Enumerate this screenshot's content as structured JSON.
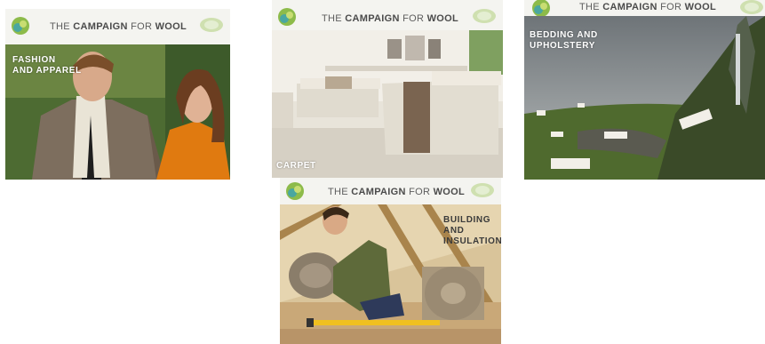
{
  "header_text_light": "THE ",
  "header_text_bold": "CAMPAIGN",
  "header_text_light2": " FOR ",
  "header_text_bold2": "WOOL",
  "panels": [
    {
      "lines": [
        "FASHION",
        "AND APPAREL"
      ]
    },
    {
      "lines": [
        "CARPET"
      ]
    },
    {
      "lines": [
        "BEDDING AND",
        "UPHOLSTERY"
      ]
    },
    {
      "lines": [
        "BUILDING AND",
        "INSULATION"
      ]
    }
  ],
  "colors": {
    "logo_green": "#8dbb4a",
    "logo_teal": "#4aa7a0",
    "orange_coat": "#e07a10"
  }
}
